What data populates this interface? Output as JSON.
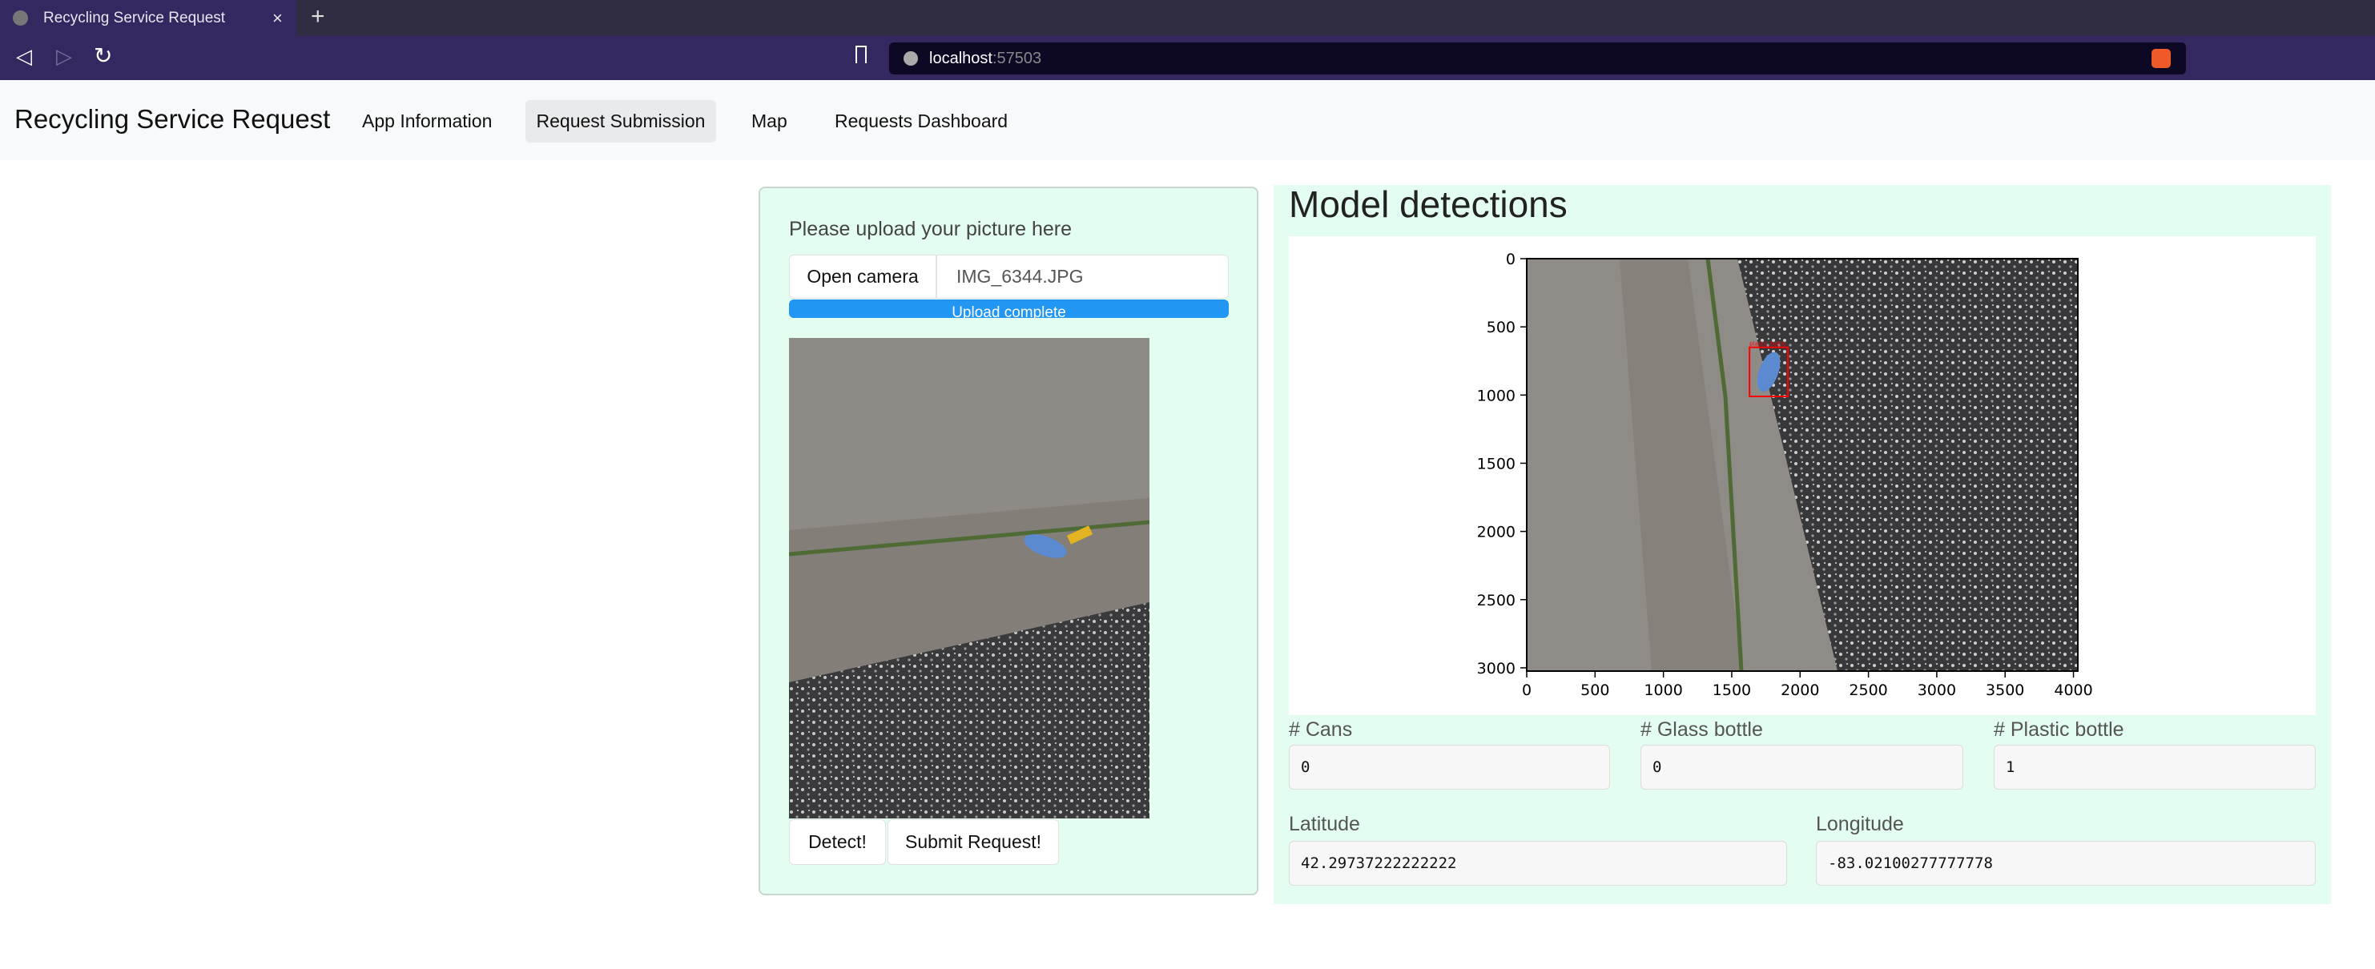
{
  "browser": {
    "tab_title": "Recycling Service Request",
    "url_host": "localhost",
    "url_port": ":57503"
  },
  "nav": {
    "brand": "Recycling Service Request",
    "items": [
      {
        "label": "App Information"
      },
      {
        "label": "Request Submission",
        "active": true
      },
      {
        "label": "Map"
      },
      {
        "label": "Requests Dashboard"
      }
    ]
  },
  "upload": {
    "prompt": "Please upload your picture here",
    "camera_label": "Open camera",
    "file_name": "IMG_6344.JPG",
    "progress_text": "Upload complete",
    "progress": 1.0,
    "detect_label": "Detect!",
    "submit_label": "Submit Request!"
  },
  "detections": {
    "title": "Model detections",
    "plot": {
      "x_ticks": [
        0,
        500,
        1000,
        1500,
        2000,
        2500,
        3000,
        3500,
        4000
      ],
      "y_ticks": [
        0,
        500,
        1000,
        1500,
        2000,
        2500,
        3000
      ],
      "xlim": [
        0,
        4032
      ],
      "ylim": [
        3024,
        0
      ],
      "boxes": [
        {
          "label": "plastic bottle",
          "x0": 1630,
          "y0": 650,
          "x1": 1910,
          "y1": 1010,
          "color": "#ff0000"
        }
      ]
    },
    "counts": [
      {
        "label": "# Cans",
        "value": "0"
      },
      {
        "label": "# Glass bottle",
        "value": "0"
      },
      {
        "label": "# Plastic bottle",
        "value": "1"
      }
    ],
    "latitude": {
      "label": "Latitude",
      "value": "42.29737222222222"
    },
    "longitude": {
      "label": "Longitude",
      "value": "-83.02100277777778"
    }
  },
  "colors": {
    "panel": "#e3fdf0",
    "progress": "#2196f3",
    "browser": "#35275f"
  }
}
